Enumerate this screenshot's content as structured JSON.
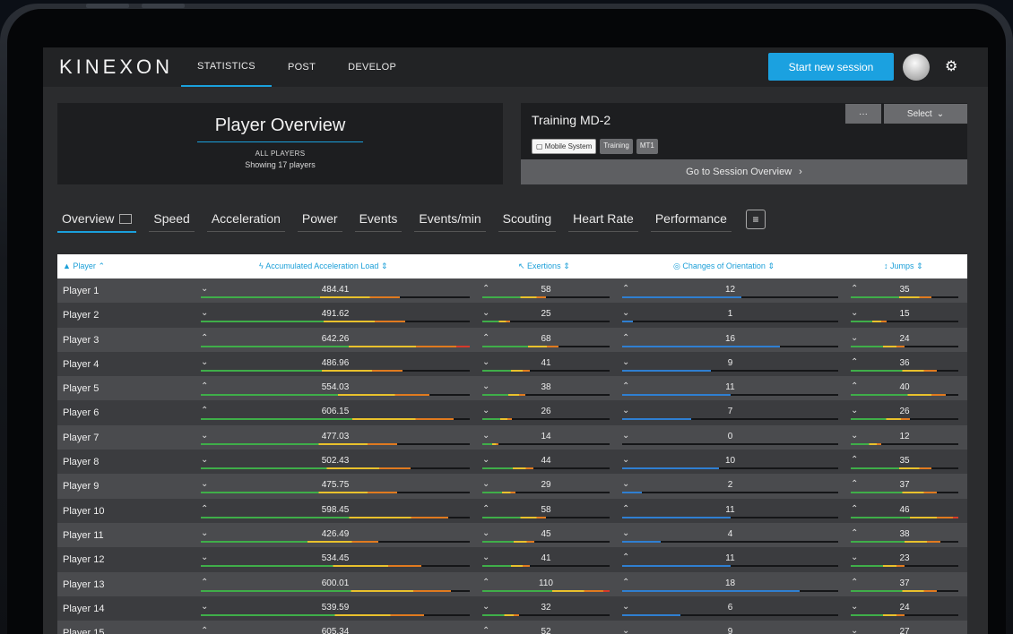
{
  "brand": {
    "logo_text": "KINEXON"
  },
  "nav": {
    "tabs": [
      {
        "label": "STATISTICS",
        "active": true
      },
      {
        "label": "POST",
        "active": false
      },
      {
        "label": "DEVELOP",
        "active": false
      }
    ],
    "start_button": "Start new session",
    "accent": "#1ba1e0"
  },
  "overview": {
    "title": "Player Overview",
    "subtitle": "ALL PLAYERS",
    "count_text": "Showing 17 players"
  },
  "session": {
    "title": "Training MD-2",
    "tags": [
      "Mobile System",
      "Training",
      "MT1"
    ],
    "more_label": "···",
    "select_label": "Select",
    "goto_label": "Go to Session Overview"
  },
  "metric_tabs": [
    {
      "label": "Overview",
      "active": true
    },
    {
      "label": "Speed"
    },
    {
      "label": "Acceleration"
    },
    {
      "label": "Power"
    },
    {
      "label": "Events"
    },
    {
      "label": "Events/min"
    },
    {
      "label": "Scouting"
    },
    {
      "label": "Heart Rate"
    },
    {
      "label": "Performance"
    }
  ],
  "table": {
    "headers": {
      "player": "Player",
      "acc_load": "Accumulated Acceleration Load",
      "exertions": "Exertions",
      "orientation": "Changes of Orientation",
      "jumps": "Jumps"
    },
    "rows": [
      {
        "player": "Player 1",
        "acc": "484.41",
        "acc_up": false,
        "acc_frac": 0.74,
        "ex": "58",
        "ex_up": true,
        "ex_frac": 0.5,
        "co": "12",
        "co_up": true,
        "co_frac": 0.55,
        "j": "35",
        "j_up": true,
        "j_frac": 0.75
      },
      {
        "player": "Player 2",
        "acc": "491.62",
        "acc_up": false,
        "acc_frac": 0.76,
        "ex": "25",
        "ex_up": false,
        "ex_frac": 0.22,
        "co": "1",
        "co_up": false,
        "co_frac": 0.05,
        "j": "15",
        "j_up": false,
        "j_frac": 0.33
      },
      {
        "player": "Player 3",
        "acc": "642.26",
        "acc_up": true,
        "acc_frac": 1.0,
        "ex": "68",
        "ex_up": true,
        "ex_frac": 0.6,
        "co": "16",
        "co_up": true,
        "co_frac": 0.73,
        "j": "24",
        "j_up": false,
        "j_frac": 0.5
      },
      {
        "player": "Player 4",
        "acc": "486.96",
        "acc_up": false,
        "acc_frac": 0.75,
        "ex": "41",
        "ex_up": false,
        "ex_frac": 0.37,
        "co": "9",
        "co_up": false,
        "co_frac": 0.41,
        "j": "36",
        "j_up": true,
        "j_frac": 0.8
      },
      {
        "player": "Player 5",
        "acc": "554.03",
        "acc_up": true,
        "acc_frac": 0.85,
        "ex": "38",
        "ex_up": false,
        "ex_frac": 0.34,
        "co": "11",
        "co_up": true,
        "co_frac": 0.5,
        "j": "40",
        "j_up": true,
        "j_frac": 0.88
      },
      {
        "player": "Player 6",
        "acc": "606.15",
        "acc_up": true,
        "acc_frac": 0.94,
        "ex": "26",
        "ex_up": false,
        "ex_frac": 0.23,
        "co": "7",
        "co_up": false,
        "co_frac": 0.32,
        "j": "26",
        "j_up": false,
        "j_frac": 0.55
      },
      {
        "player": "Player 7",
        "acc": "477.03",
        "acc_up": false,
        "acc_frac": 0.73,
        "ex": "14",
        "ex_up": false,
        "ex_frac": 0.13,
        "co": "0",
        "co_up": false,
        "co_frac": 0.0,
        "j": "12",
        "j_up": false,
        "j_frac": 0.28
      },
      {
        "player": "Player 8",
        "acc": "502.43",
        "acc_up": false,
        "acc_frac": 0.78,
        "ex": "44",
        "ex_up": false,
        "ex_frac": 0.4,
        "co": "10",
        "co_up": false,
        "co_frac": 0.45,
        "j": "35",
        "j_up": true,
        "j_frac": 0.75
      },
      {
        "player": "Player 9",
        "acc": "475.75",
        "acc_up": false,
        "acc_frac": 0.73,
        "ex": "29",
        "ex_up": false,
        "ex_frac": 0.26,
        "co": "2",
        "co_up": false,
        "co_frac": 0.09,
        "j": "37",
        "j_up": true,
        "j_frac": 0.8
      },
      {
        "player": "Player 10",
        "acc": "598.45",
        "acc_up": true,
        "acc_frac": 0.92,
        "ex": "58",
        "ex_up": true,
        "ex_frac": 0.5,
        "co": "11",
        "co_up": true,
        "co_frac": 0.5,
        "j": "46",
        "j_up": true,
        "j_frac": 1.0
      },
      {
        "player": "Player 11",
        "acc": "426.49",
        "acc_up": false,
        "acc_frac": 0.66,
        "ex": "45",
        "ex_up": false,
        "ex_frac": 0.41,
        "co": "4",
        "co_up": false,
        "co_frac": 0.18,
        "j": "38",
        "j_up": true,
        "j_frac": 0.83
      },
      {
        "player": "Player 12",
        "acc": "534.45",
        "acc_up": false,
        "acc_frac": 0.82,
        "ex": "41",
        "ex_up": false,
        "ex_frac": 0.37,
        "co": "11",
        "co_up": true,
        "co_frac": 0.5,
        "j": "23",
        "j_up": false,
        "j_frac": 0.5
      },
      {
        "player": "Player 13",
        "acc": "600.01",
        "acc_up": true,
        "acc_frac": 0.93,
        "ex": "110",
        "ex_up": true,
        "ex_frac": 1.0,
        "co": "18",
        "co_up": true,
        "co_frac": 0.82,
        "j": "37",
        "j_up": true,
        "j_frac": 0.8
      },
      {
        "player": "Player 14",
        "acc": "539.59",
        "acc_up": false,
        "acc_frac": 0.83,
        "ex": "32",
        "ex_up": false,
        "ex_frac": 0.29,
        "co": "6",
        "co_up": false,
        "co_frac": 0.27,
        "j": "24",
        "j_up": false,
        "j_frac": 0.5
      },
      {
        "player": "Player 15",
        "acc": "605.34",
        "acc_up": true,
        "acc_frac": 0.94,
        "ex": "52",
        "ex_up": true,
        "ex_frac": 0.47,
        "co": "9",
        "co_up": false,
        "co_frac": 0.41,
        "j": "27",
        "j_up": false,
        "j_frac": 0.58
      }
    ]
  },
  "colors": {
    "green": "#3fae49",
    "yellow": "#e9c12c",
    "orange": "#e07a1f",
    "red": "#d63a2a",
    "blue": "#2f7fd1"
  }
}
